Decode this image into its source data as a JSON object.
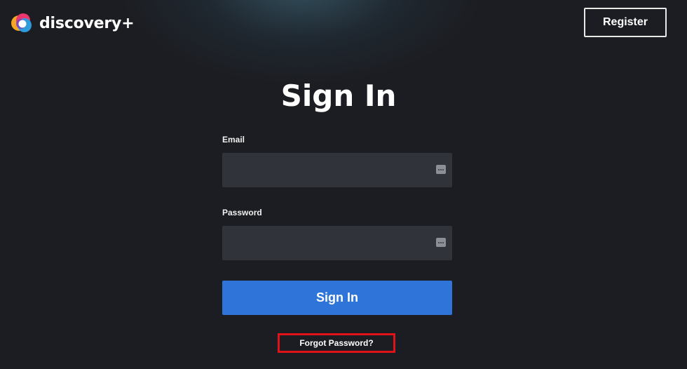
{
  "header": {
    "logo_text": "discovery+",
    "register_label": "Register"
  },
  "main": {
    "title": "Sign In",
    "email": {
      "label": "Email",
      "value": "",
      "placeholder": ""
    },
    "password": {
      "label": "Password",
      "value": "",
      "placeholder": ""
    },
    "signin_label": "Sign In",
    "forgot_label": "Forgot Password?"
  },
  "icons": {
    "logo": "discovery-globe-icon",
    "field_autofill": "password-manager-dots-icon"
  },
  "colors": {
    "background": "#1c1d22",
    "field_bg": "#30333a",
    "primary_button": "#2f74d9",
    "highlight_box": "#e0131a",
    "text": "#ffffff"
  }
}
